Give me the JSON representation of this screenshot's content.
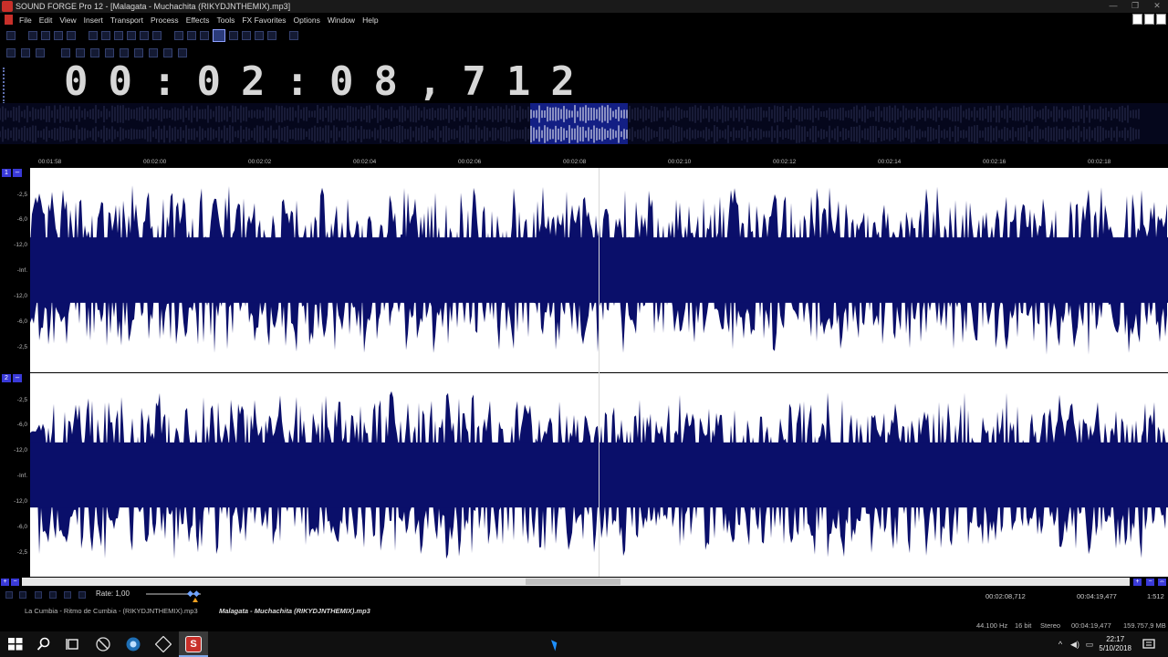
{
  "window": {
    "title": "SOUND FORGE Pro 12 - [Malagata - Muchachita (RIKYDJNTHEMIX).mp3]",
    "controls": [
      "—",
      "❐",
      "✕"
    ]
  },
  "menu": {
    "items": [
      "File",
      "Edit",
      "View",
      "Insert",
      "Transport",
      "Process",
      "Effects",
      "Tools",
      "FX Favorites",
      "Options",
      "Window",
      "Help"
    ]
  },
  "time_display": "00:02:08,712",
  "ruler": {
    "labels": [
      "00:01:58",
      "00:02:00",
      "00:02:02",
      "00:02:04",
      "00:02:06",
      "00:02:08",
      "00:02:10",
      "00:02:12",
      "00:02:14",
      "00:02:16",
      "00:02:18"
    ]
  },
  "channels": [
    {
      "number": "1",
      "db_labels": [
        "-2,5",
        "-6,0",
        "-12,0",
        "-Inf.",
        "-12,0",
        "-6,0",
        "-2,5"
      ]
    },
    {
      "number": "2",
      "db_labels": [
        "-2,5",
        "-6,0",
        "-12,0",
        "-Inf.",
        "-12,0",
        "-6,0",
        "-2,5"
      ]
    }
  ],
  "transport": {
    "rate_label": "Rate: 1,00",
    "cursor_position": "00:02:08,712",
    "file_length": "00:04:19,477",
    "zoom_ratio": "1:512"
  },
  "document_tabs": [
    "La Cumbia - Ritmo de Cumbia - (RIKYDJNTHEMIX).mp3",
    "Malagata - Muchachita (RIKYDJNTHEMIX).mp3"
  ],
  "status": {
    "sample_rate": "44.100 Hz",
    "bit_depth": "16 bit",
    "channels": "Stereo",
    "length": "00:04:19,477",
    "disk_space": "159.757,9 MB"
  },
  "taskbar": {
    "time": "22:17",
    "date": "5/10/2018"
  },
  "colors": {
    "waveform": "#0a0f6a",
    "waveform_background": "#ffffff",
    "app_accent": "#c8302a",
    "channel_button": "#3a3ad8"
  }
}
